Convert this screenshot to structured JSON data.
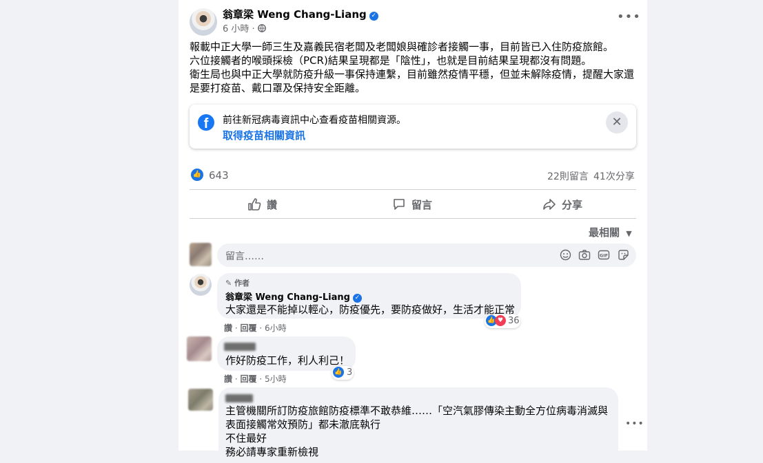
{
  "post": {
    "author_name": "翁章梁 Weng Chang-Liang",
    "time": "6 小時",
    "separator": "·",
    "audience_icon": "globe-icon",
    "more_icon": "more-dots-icon",
    "text_lines": [
      "報載中正大學一師三生及嘉義民宿老闆及老闆娘與確診者接觸一事，目前皆已入住防疫旅館。",
      "六位接觸者的喉頭採檢（PCR)結果呈現都是「陰性」，也就是目前結果呈現都沒有問題。",
      "衛生局也與中正大學就防疫升級一事保持連繫，目前雖然疫情平穩，但並未解除疫情，提醒大家還",
      "是要打疫苗、戴口罩及保持安全距離。"
    ]
  },
  "info_card": {
    "text": "前往新冠病毒資訊中心查看疫苗相關資源。",
    "link": "取得疫苗相關資訊"
  },
  "stats": {
    "likes": "643",
    "comments": "22則留言",
    "shares": "41次分享"
  },
  "actions": {
    "like": "讚",
    "comment": "留言",
    "share": "分享"
  },
  "sort": {
    "label": "最相關"
  },
  "composer": {
    "placeholder": "留言……"
  },
  "comments": [
    {
      "badge": "作者",
      "author": "翁章梁 Weng Chang-Liang",
      "text": "大家還是不能掉以輕心，防疫優先，要防疫做好，生活才能正常",
      "like": "讚",
      "reply": "回覆",
      "time": "6小時",
      "reactions": "36"
    },
    {
      "text": "作好防疫工作，利人利己！",
      "like": "讚",
      "reply": "回覆",
      "time": "5小時",
      "reactions": "3"
    },
    {
      "text_lines": [
        "主管機關所訂防疫旅館防疫標準不敢恭維……「空汽氣膠傳染主動全方位病毒消滅與",
        "表面接觸常效預防」都未澈底執行",
        "不住最好",
        "務必請專家重新檢視"
      ]
    }
  ],
  "colors": {
    "accent": "#1b74e4",
    "background": "#f0f2f5",
    "heart": "#f33e58"
  }
}
